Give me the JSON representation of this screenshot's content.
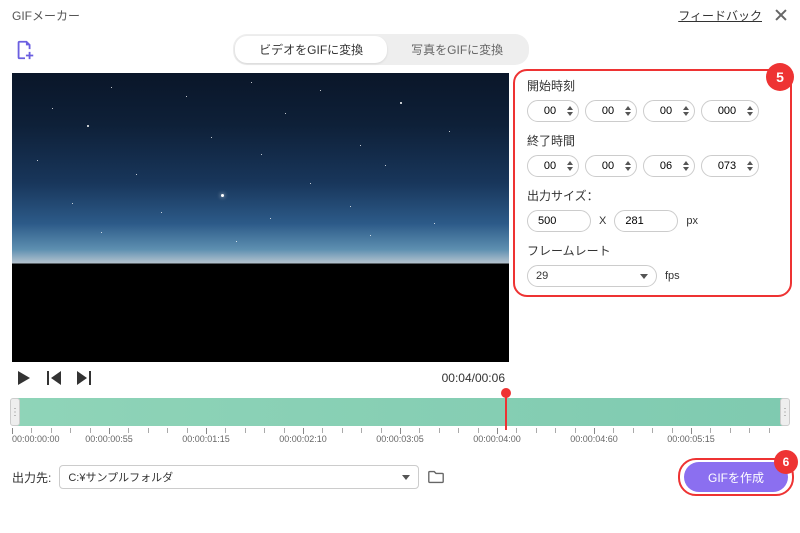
{
  "header": {
    "title": "GIFメーカー",
    "feedback": "フィードバック"
  },
  "tabs": {
    "video": "ビデオをGIFに変換",
    "photo": "写真をGIFに変換"
  },
  "player": {
    "time": "00:04/00:06"
  },
  "settings": {
    "start_label": "開始時刻",
    "start": {
      "h": "00",
      "m": "00",
      "s": "00",
      "ms": "000"
    },
    "end_label": "終了時間",
    "end": {
      "h": "00",
      "m": "00",
      "s": "06",
      "ms": "073"
    },
    "size_label": "出力サイズ：",
    "size": {
      "w": "500",
      "h": "281",
      "x": "X",
      "unit": "px"
    },
    "fps_label": "フレームレート",
    "fps": {
      "value": "29",
      "unit": "fps"
    }
  },
  "callouts": {
    "five": "5",
    "six": "6"
  },
  "ruler": [
    "00:00:00:00",
    "00:00:00:55",
    "00:00:01:15",
    "00:00:02:10",
    "00:00:03:05",
    "00:00:04:00",
    "00:00:04:60",
    "00:00:05:15"
  ],
  "footer": {
    "output_label": "出力先:",
    "output_path": "C:¥サンプルフォルダ",
    "create": "GIFを作成"
  }
}
